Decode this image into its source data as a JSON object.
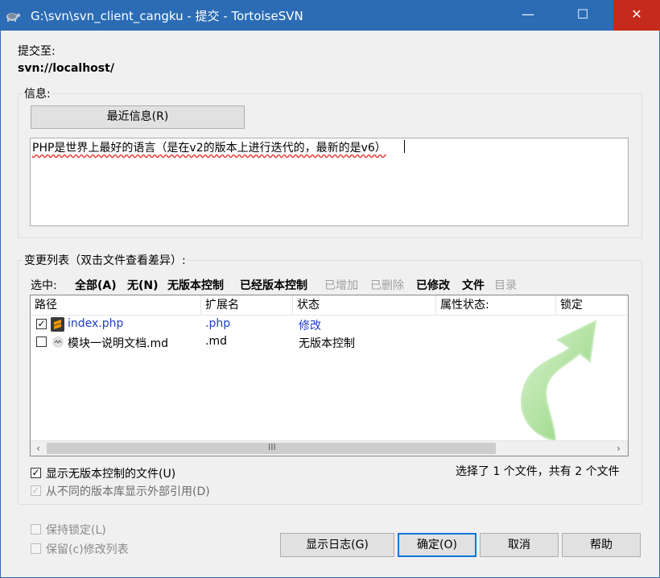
{
  "window": {
    "title": "G:\\svn\\svn_client_cangku - 提交 - TortoiseSVN",
    "minimize_glyph": "—",
    "maximize_glyph": "☐",
    "close_glyph": "✕"
  },
  "commit_to": {
    "label": "提交至:",
    "url": "svn://localhost/"
  },
  "message": {
    "group_label": "信息:",
    "recent_button": "最近信息(R)",
    "text": "PHP是世界上最好的语言（是在v2的版本上进行迭代的，最新的是v6）"
  },
  "changes": {
    "group_label": "变更列表（双击文件查看差异）:",
    "select_label": "选中:",
    "filters": [
      {
        "label": "全部(A)",
        "enabled": true
      },
      {
        "label": "无(N)",
        "enabled": true
      },
      {
        "label": "无版本控制",
        "enabled": true
      },
      {
        "label": "已经版本控制",
        "enabled": true
      },
      {
        "label": "已增加",
        "enabled": false
      },
      {
        "label": "已删除",
        "enabled": false
      },
      {
        "label": "已修改",
        "enabled": true
      },
      {
        "label": "文件",
        "enabled": true
      },
      {
        "label": "目录",
        "enabled": false
      }
    ],
    "columns": [
      "路径",
      "扩展名",
      "状态",
      "属性状态:",
      "锁定"
    ],
    "rows": [
      {
        "checked": true,
        "path": "index.php",
        "ext": ".php",
        "status": "修改",
        "icon": "sublime-file-icon"
      },
      {
        "checked": false,
        "path": "模块一说明文档.md",
        "ext": ".md",
        "status": "无版本控制",
        "icon": "unversioned-file-icon"
      }
    ],
    "scroll_grip": "III",
    "show_unversioned": {
      "label": "显示无版本控制的文件(U)",
      "checked": true
    },
    "show_externals": {
      "label": "从不同的版本库显示外部引用(D)",
      "checked": true,
      "enabled": false
    },
    "summary": "选择了 1 个文件，共有 2 个文件"
  },
  "options": {
    "keep_locks": {
      "label": "保持锁定(L)",
      "checked": false
    },
    "keep_changelist": {
      "label": "保留(c)修改列表",
      "checked": false
    }
  },
  "buttons": {
    "show_log": "显示日志(G)",
    "ok": "确定(O)",
    "cancel": "取消",
    "help": "帮助"
  },
  "colors": {
    "titlebar": "#2b6cb5",
    "close_button": "#c42b1c",
    "link_blue": "#1f3fc4",
    "watermark_green": "#9ad98a"
  }
}
